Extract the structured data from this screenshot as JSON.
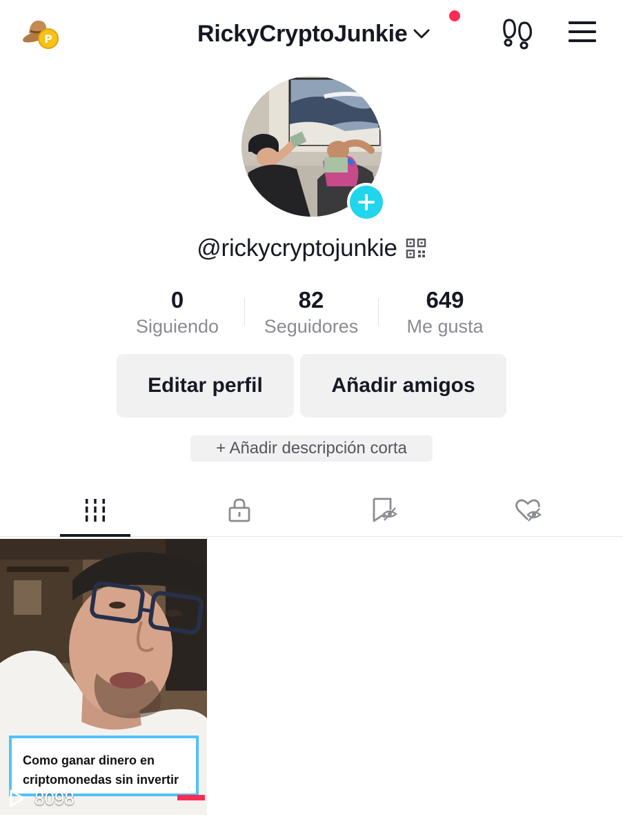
{
  "header": {
    "username": "RickyCryptoJunkie",
    "notification_dot_color": "#fe2c55",
    "icons": [
      "promo-coin-icon",
      "chevron-down-icon",
      "footprints-icon",
      "menu-icon"
    ]
  },
  "profile": {
    "handle": "@rickycryptojunkie",
    "stats": [
      {
        "value": "0",
        "label": "Siguiendo"
      },
      {
        "value": "82",
        "label": "Seguidores"
      },
      {
        "value": "649",
        "label": "Me gusta"
      }
    ],
    "buttons": {
      "edit": "Editar perfil",
      "add_friends": "Añadir amigos"
    },
    "bio_prompt": "+ Añadir descripción corta",
    "accent_color": "#20d5ec"
  },
  "tabs": [
    {
      "icon": "grid-icon",
      "active": true
    },
    {
      "icon": "lock-icon",
      "active": false
    },
    {
      "icon": "bookmark-hidden-icon",
      "active": false
    },
    {
      "icon": "heart-hidden-icon",
      "active": false
    }
  ],
  "videos": [
    {
      "caption": "Como ganar dinero en criptomonedas sin invertir",
      "views": "8098"
    }
  ]
}
